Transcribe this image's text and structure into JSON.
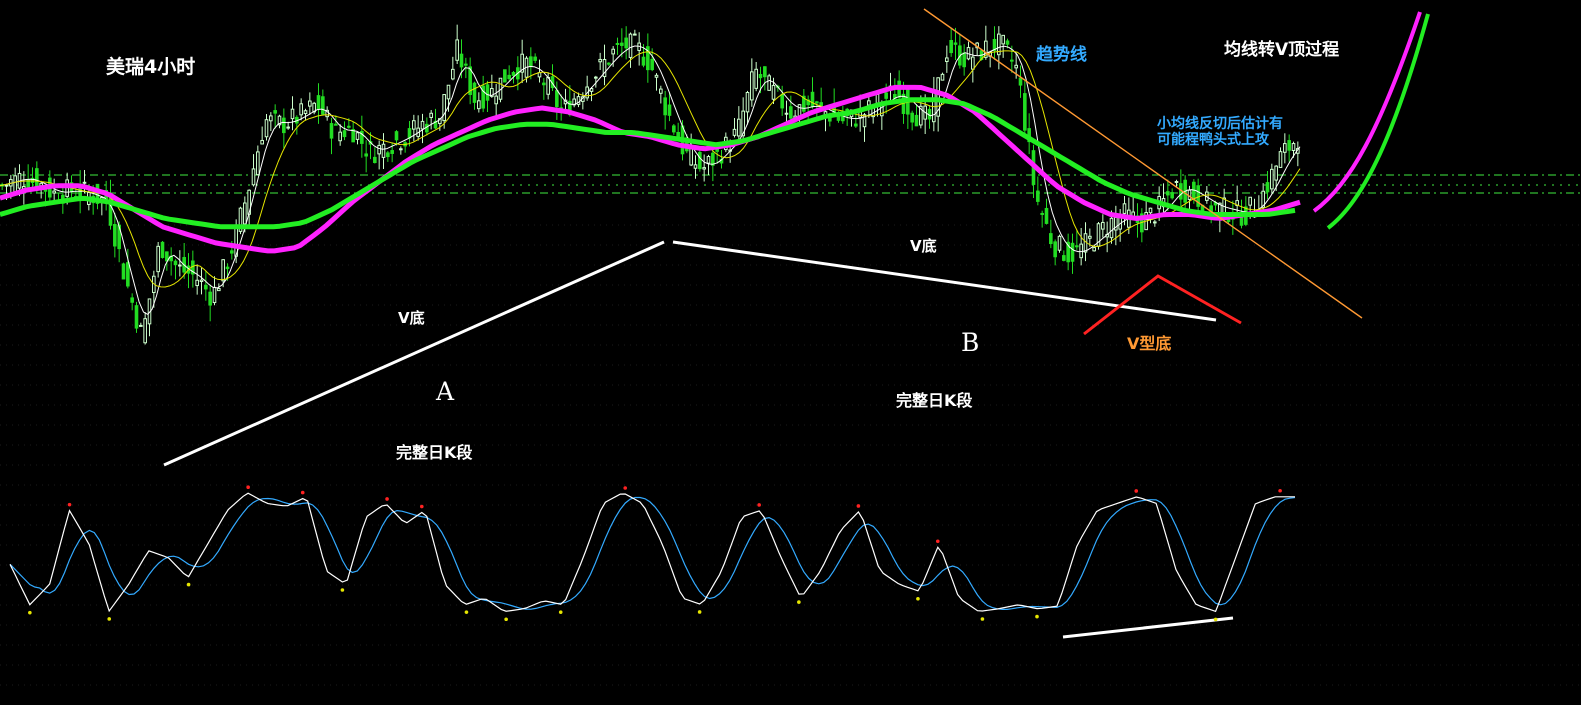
{
  "labels": {
    "title": "美瑞4小时",
    "trendline": "趋势线",
    "ma_reversal": "均线转V顶过程",
    "note_line1": "小均线反切后估计有",
    "note_line2": "可能程鸭头式上攻",
    "v_bottom_1": "V底",
    "v_bottom_2": "V底",
    "v_shape_bottom": "V型底",
    "segment_a": "A",
    "segment_b": "B",
    "daily_segment_1": "完整日K段",
    "daily_segment_2": "完整日K段"
  },
  "colors": {
    "background": "#000000",
    "candle_up": "#ccffcc",
    "candle_down": "#22dd22",
    "ma_short": "#ffffff",
    "ma_mid": "#e6e600",
    "ma_magenta": "#ff22ff",
    "ma_green": "#22ee22",
    "grid_dash": "#33bb33",
    "trendline": "#ff9933",
    "annotation_blue": "#33aaff",
    "v_shape": "#ff2222",
    "osc_k": "#ffffff",
    "osc_d": "#33aaff",
    "dot_red": "#ff2222",
    "dot_yellow": "#e6e600"
  },
  "chart_data": {
    "type": "candlestick",
    "title": "美瑞4小时",
    "grid": "dashed horizontal reference lines",
    "series": [
      {
        "name": "candles",
        "price_path": [
          0.62,
          0.64,
          0.63,
          0.6,
          0.61,
          0.6,
          0.58,
          0.4,
          0.25,
          0.48,
          0.42,
          0.4,
          0.35,
          0.45,
          0.6,
          0.78,
          0.77,
          0.79,
          0.82,
          0.75,
          0.76,
          0.7,
          0.72,
          0.74,
          0.77,
          0.79,
          0.95,
          0.83,
          0.85,
          0.9,
          0.92,
          0.87,
          0.8,
          0.85,
          0.9,
          0.95,
          0.97,
          0.92,
          0.8,
          0.7,
          0.66,
          0.7,
          0.75,
          0.9,
          0.85,
          0.8,
          0.82,
          0.8,
          0.78,
          0.79,
          0.82,
          0.85,
          0.8,
          0.78,
          0.96,
          0.93,
          0.95,
          0.97,
          0.9,
          0.6,
          0.48,
          0.45,
          0.48,
          0.52,
          0.55,
          0.53,
          0.56,
          0.62,
          0.6,
          0.57,
          0.56,
          0.55,
          0.6,
          0.69,
          0.74
        ]
      },
      {
        "name": "ma_short"
      },
      {
        "name": "ma_mid"
      },
      {
        "name": "ma_magenta",
        "path": [
          0.59,
          0.61,
          0.62,
          0.62,
          0.6,
          0.56,
          0.52,
          0.5,
          0.48,
          0.47,
          0.46,
          0.47,
          0.52,
          0.58,
          0.63,
          0.68,
          0.72,
          0.75,
          0.78,
          0.8,
          0.81,
          0.8,
          0.78,
          0.75,
          0.74,
          0.72,
          0.71,
          0.72,
          0.74,
          0.77,
          0.8,
          0.82,
          0.84,
          0.86,
          0.86,
          0.84,
          0.8,
          0.74,
          0.68,
          0.62,
          0.58,
          0.55,
          0.54,
          0.55,
          0.55,
          0.54,
          0.55,
          0.56,
          0.58
        ]
      },
      {
        "name": "ma_green",
        "path": [
          0.55,
          0.57,
          0.58,
          0.59,
          0.58,
          0.56,
          0.54,
          0.53,
          0.52,
          0.52,
          0.52,
          0.53,
          0.56,
          0.6,
          0.64,
          0.68,
          0.71,
          0.74,
          0.76,
          0.77,
          0.77,
          0.76,
          0.75,
          0.75,
          0.74,
          0.73,
          0.72,
          0.73,
          0.75,
          0.77,
          0.79,
          0.8,
          0.82,
          0.83,
          0.83,
          0.82,
          0.79,
          0.75,
          0.71,
          0.67,
          0.63,
          0.6,
          0.58,
          0.56,
          0.55,
          0.55,
          0.55,
          0.56
        ]
      }
    ],
    "oscillator": {
      "type": "line",
      "series": [
        {
          "name": "K",
          "values": [
            0.45,
            0.15,
            0.3,
            0.85,
            0.6,
            0.1,
            0.3,
            0.55,
            0.5,
            0.35,
            0.6,
            0.85,
            0.98,
            0.9,
            0.88,
            0.95,
            0.4,
            0.3,
            0.8,
            0.9,
            0.75,
            0.85,
            0.3,
            0.15,
            0.2,
            0.1,
            0.12,
            0.18,
            0.15,
            0.5,
            0.9,
            0.98,
            0.9,
            0.6,
            0.2,
            0.15,
            0.4,
            0.8,
            0.85,
            0.5,
            0.2,
            0.4,
            0.7,
            0.85,
            0.4,
            0.3,
            0.25,
            0.6,
            0.2,
            0.1,
            0.12,
            0.15,
            0.12,
            0.14,
            0.6,
            0.85,
            0.9,
            0.95,
            0.9,
            0.4,
            0.15,
            0.1,
            0.5,
            0.9,
            0.95,
            0.95
          ]
        },
        {
          "name": "D"
        }
      ]
    }
  }
}
